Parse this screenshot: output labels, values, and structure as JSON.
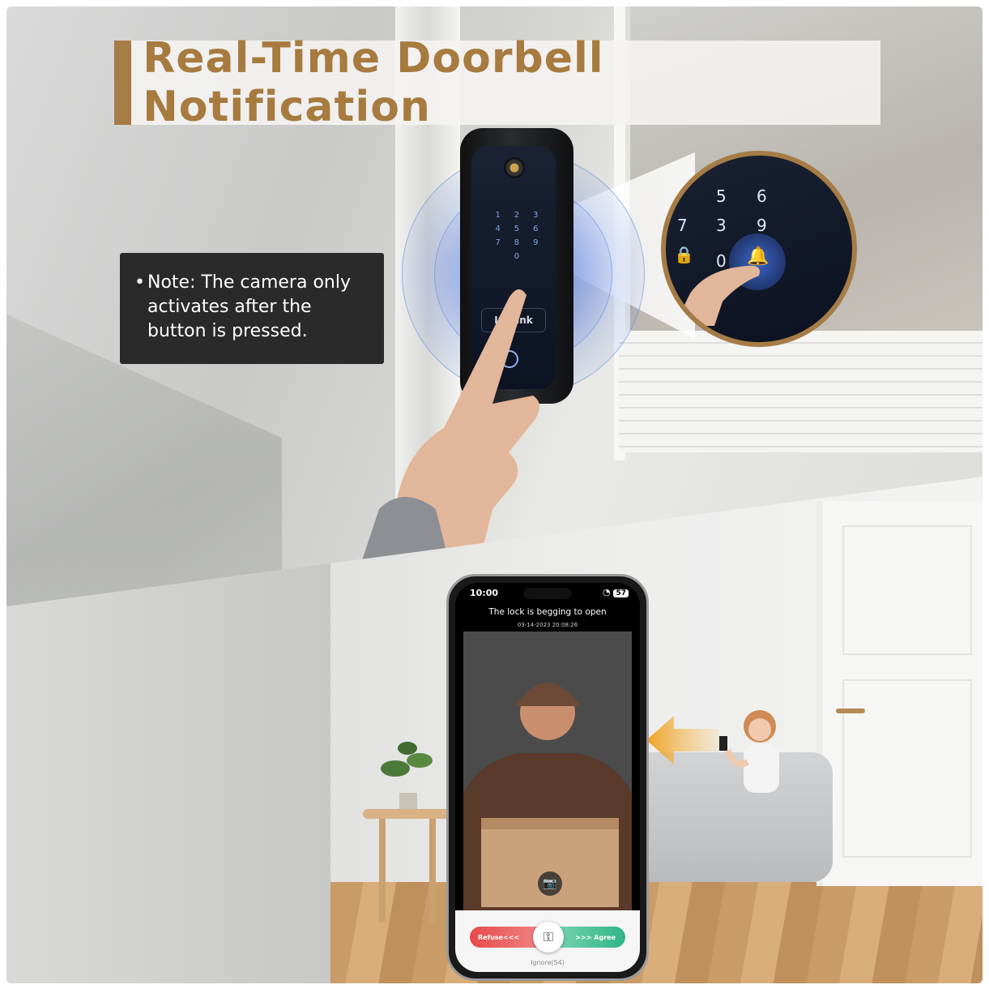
{
  "title": "Real-Time Doorbell Notification",
  "note": {
    "bullet": "•",
    "text": "Note: The camera only activates after the button is pressed."
  },
  "lock": {
    "brand": "IOTlink",
    "keys": [
      "1",
      "2",
      "3",
      "4",
      "5",
      "6",
      "7",
      "8",
      "9",
      "",
      "0",
      ""
    ],
    "zoom_keys": [
      "5",
      "6",
      "7",
      "3",
      "9",
      "0"
    ]
  },
  "phone": {
    "time": "10:00",
    "battery": "57",
    "notification_title": "The lock is begging to open",
    "timestamp": "03-14-2023 20:08:26",
    "refuse_label": "Refuse<<<",
    "agree_label": ">>> Agree",
    "ignore_label": "Ignore(54)"
  },
  "colors": {
    "accent": "#a67c46",
    "refuse": "#e84a4a",
    "agree": "#2fb587"
  }
}
